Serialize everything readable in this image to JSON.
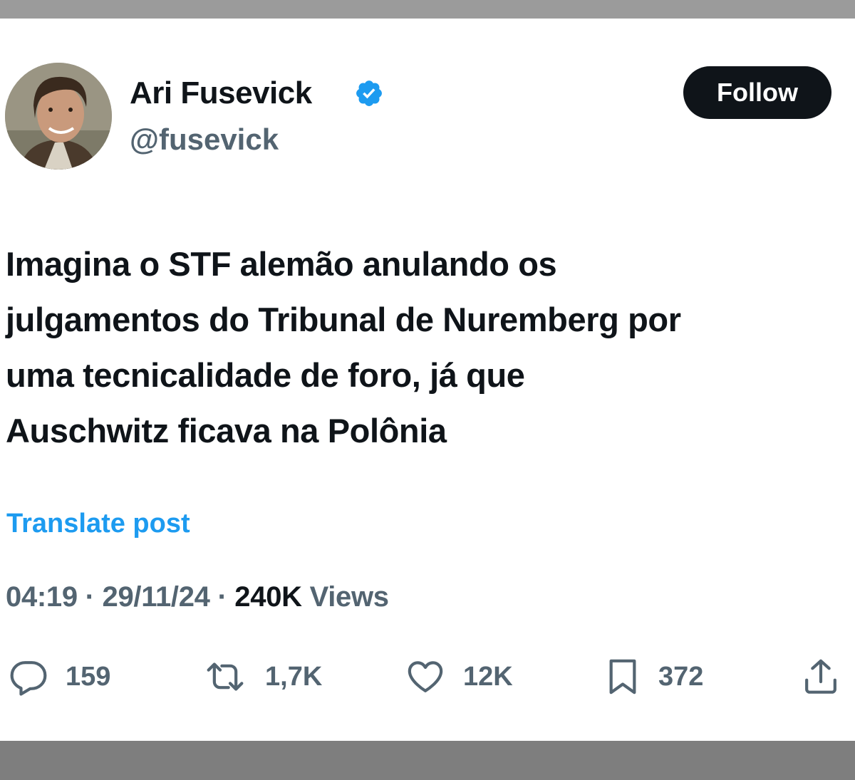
{
  "author": {
    "display_name": "Ari Fusevick",
    "handle": "@fusevick",
    "verified": true
  },
  "follow_button": {
    "label": "Follow"
  },
  "post": {
    "lines": [
      "Imagina o STF alemão anulando os",
      "julgamentos do Tribunal de Nuremberg por",
      "uma tecnicalidade de foro, já que",
      "Auschwitz ficava na Polônia"
    ],
    "translate_label": "Translate post"
  },
  "meta": {
    "time": "04:19",
    "separator": "·",
    "date": "29/11/24",
    "views_count": "240K",
    "views_label": "Views"
  },
  "actions": {
    "replies": "159",
    "reposts": "1,7K",
    "likes": "12K",
    "bookmarks": "372"
  },
  "icons": {
    "verified": "verified-badge-icon",
    "reply": "reply-icon",
    "repost": "repost-icon",
    "like": "heart-icon",
    "bookmark": "bookmark-icon",
    "share": "share-icon"
  },
  "colors": {
    "text_primary": "#0f1419",
    "text_secondary": "#536471",
    "accent_blue": "#1d9bf0",
    "follow_bg": "#0f1419"
  }
}
